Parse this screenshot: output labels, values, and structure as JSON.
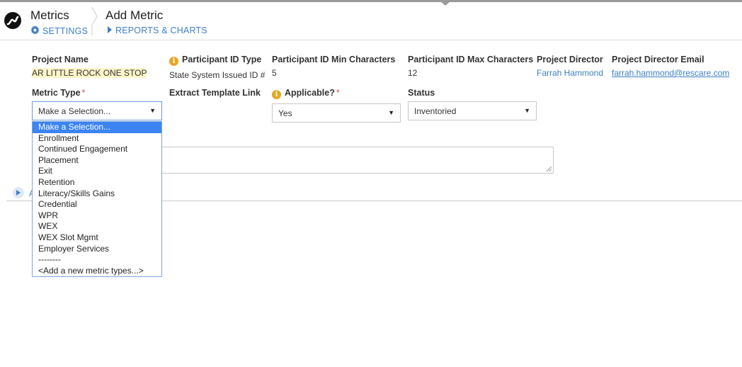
{
  "header": {
    "app_title": "Metrics",
    "page_title": "Add Metric",
    "settings_link": "SETTINGS",
    "reports_link": "REPORTS & CHARTS"
  },
  "fields": {
    "project_name": {
      "label": "Project Name",
      "value": "AR LITTLE ROCK ONE STOP"
    },
    "participant_id_type": {
      "label": "Participant ID Type",
      "value": "State System Issued ID #"
    },
    "participant_id_min": {
      "label": "Participant ID Min Characters",
      "value": "5"
    },
    "participant_id_max": {
      "label": "Participant ID Max Characters",
      "value": "12"
    },
    "project_director": {
      "label": "Project Director",
      "value": "Farrah Hammond"
    },
    "project_director_email": {
      "label": "Project Director Email",
      "value": "farrah.hammond@rescare.com"
    },
    "metric_type": {
      "label": "Metric Type",
      "required": "*",
      "selected": "Make a Selection..."
    },
    "extract_template": {
      "label": "Extract Template Link"
    },
    "applicable": {
      "label": "Applicable?",
      "required": "*",
      "selected": "Yes"
    },
    "status": {
      "label": "Status",
      "selected": "Inventoried"
    }
  },
  "metric_type_options": [
    "Make a Selection...",
    "Enrollment",
    "Continued Engagement",
    "Placement",
    "Exit",
    "Retention",
    "Literacy/Skills Gains",
    "Credential",
    "WPR",
    "WEX",
    "WEX Slot Mgmt",
    "Employer Services",
    "--------",
    "<Add a new metric types...>"
  ],
  "expander_text": "A",
  "colors": {
    "link": "#3f7fc3",
    "selected_option": "#3c84f2",
    "required": "#d9534f",
    "info": "#e8a623"
  },
  "icons": {
    "logo": "app-logo-icon",
    "settings": "gear-icon",
    "reports": "caret-right-icon",
    "info": "info-icon",
    "dropdown": "chevron-down-icon"
  }
}
